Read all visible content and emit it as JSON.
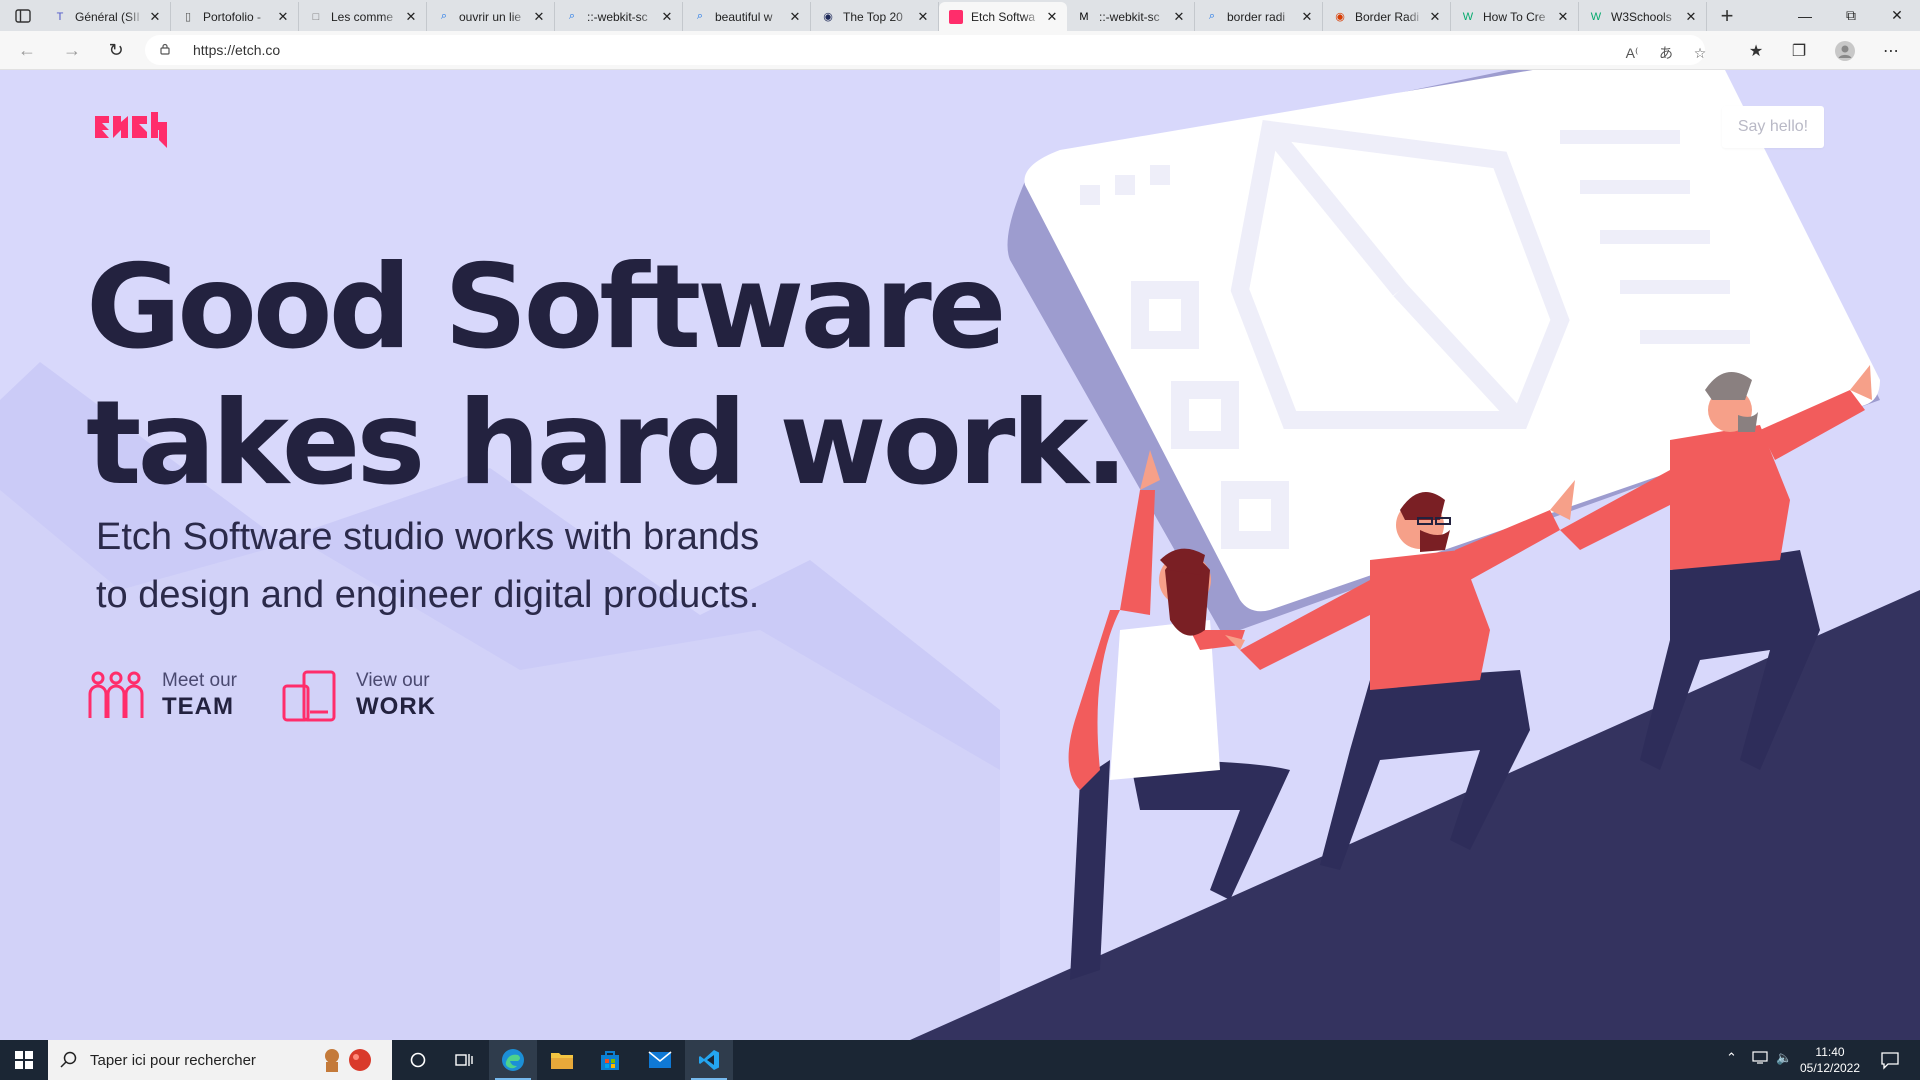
{
  "browser": {
    "tabs": [
      {
        "title": "Général (SII",
        "icon": "teams-icon",
        "color": "#5059c9"
      },
      {
        "title": "Portofolio -",
        "icon": "document-icon",
        "color": "#555555"
      },
      {
        "title": "Les comme",
        "icon": "page-icon",
        "color": "#777777"
      },
      {
        "title": "ouvrir un lie",
        "icon": "search-icon",
        "color": "#1a73e8"
      },
      {
        "title": "::-webkit-sc",
        "icon": "search-icon",
        "color": "#1a73e8"
      },
      {
        "title": "beautiful w",
        "icon": "search-icon",
        "color": "#1a73e8"
      },
      {
        "title": "The Top 20",
        "icon": "site-icon",
        "color": "#1f2a5a"
      },
      {
        "title": "Etch Softwa",
        "icon": "etch-icon",
        "color": "#ff2d6b",
        "active": true
      },
      {
        "title": "::-webkit-sc",
        "icon": "mdn-icon",
        "color": "#000000"
      },
      {
        "title": "border radi",
        "icon": "search-icon",
        "color": "#1a73e8"
      },
      {
        "title": "Border Radi",
        "icon": "site-icon",
        "color": "#d83b01"
      },
      {
        "title": "How To Cre",
        "icon": "w3schools-icon",
        "color": "#04aa6d"
      },
      {
        "title": "W3Schools",
        "icon": "w3schools-icon",
        "color": "#04aa6d"
      }
    ],
    "url": "https://etch.co"
  },
  "page": {
    "say_hello": "Say hello!",
    "headline_line1": "Good Software",
    "headline_line2": "takes hard work.",
    "tagline_line1": "Etch Software studio works with brands",
    "tagline_line2": "to design and engineer digital products.",
    "cta_team_small": "Meet our",
    "cta_team_big": "TEAM",
    "cta_work_small": "View our",
    "cta_work_big": "WORK",
    "brand_color": "#ff2d6b",
    "bg_color": "#d8d8fb",
    "dark_color": "#23223f"
  },
  "taskbar": {
    "search_placeholder": "Taper ici pour rechercher",
    "time": "11:40",
    "date": "05/12/2022"
  }
}
